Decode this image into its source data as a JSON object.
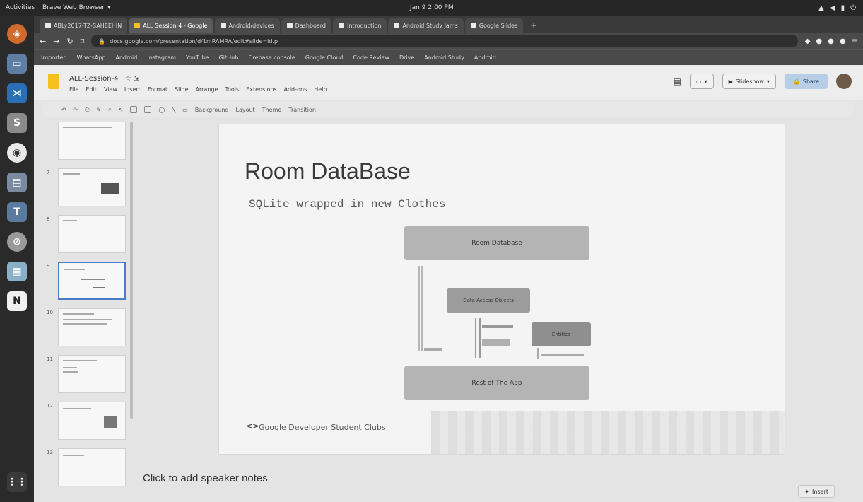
{
  "topbar": {
    "activities": "Activities",
    "app_menu": "Brave Web Browser",
    "clock": "Jan 9 2:00 PM"
  },
  "tabs": [
    {
      "label": "ABLy2017-TZ-SAHEEHIN"
    },
    {
      "label": "ALL Session 4 - Google"
    },
    {
      "label": "Android/devices"
    },
    {
      "label": "Dashboard"
    },
    {
      "label": "Introduction"
    },
    {
      "label": "Android Study Jams"
    },
    {
      "label": "Google Slides"
    }
  ],
  "address_bar": {
    "url": "docs.google.com/presentation/d/1mRAMRA/edit#slide=id.p"
  },
  "bookmarks": [
    "Imported",
    "WhatsApp",
    "Android",
    "Instagram",
    "YouTube",
    "GitHub",
    "Firebase console",
    "Google Cloud",
    "Code Review",
    "Drive",
    "Android Study",
    "Android"
  ],
  "document": {
    "title": "ALL-Session-4",
    "menu": [
      "File",
      "Edit",
      "View",
      "Insert",
      "Format",
      "Slide",
      "Arrange",
      "Tools",
      "Extensions",
      "Add-ons",
      "Help"
    ],
    "slideshow_label": "Slideshow",
    "share_label": "Share"
  },
  "toolbar": {
    "background_label": "Background",
    "layout_label": "Layout",
    "theme_label": "Theme",
    "transition_label": "Transition"
  },
  "filmstrip": {
    "slide_numbers": [
      "7",
      "8",
      "9",
      "10",
      "11",
      "12",
      "13"
    ]
  },
  "slide": {
    "title": "Room DataBase",
    "subtitle": "SQLite wrapped in new Clothes",
    "diagram": {
      "room_database": "Room Database",
      "dao": "Data Access Objects",
      "entities": "Entities",
      "rest_of_app": "Rest of The App"
    },
    "footer_logo": "<>",
    "footer_text": "Google Developer Student Clubs"
  },
  "notes": {
    "placeholder": "Click to add speaker notes"
  },
  "explore_label": "Insert"
}
